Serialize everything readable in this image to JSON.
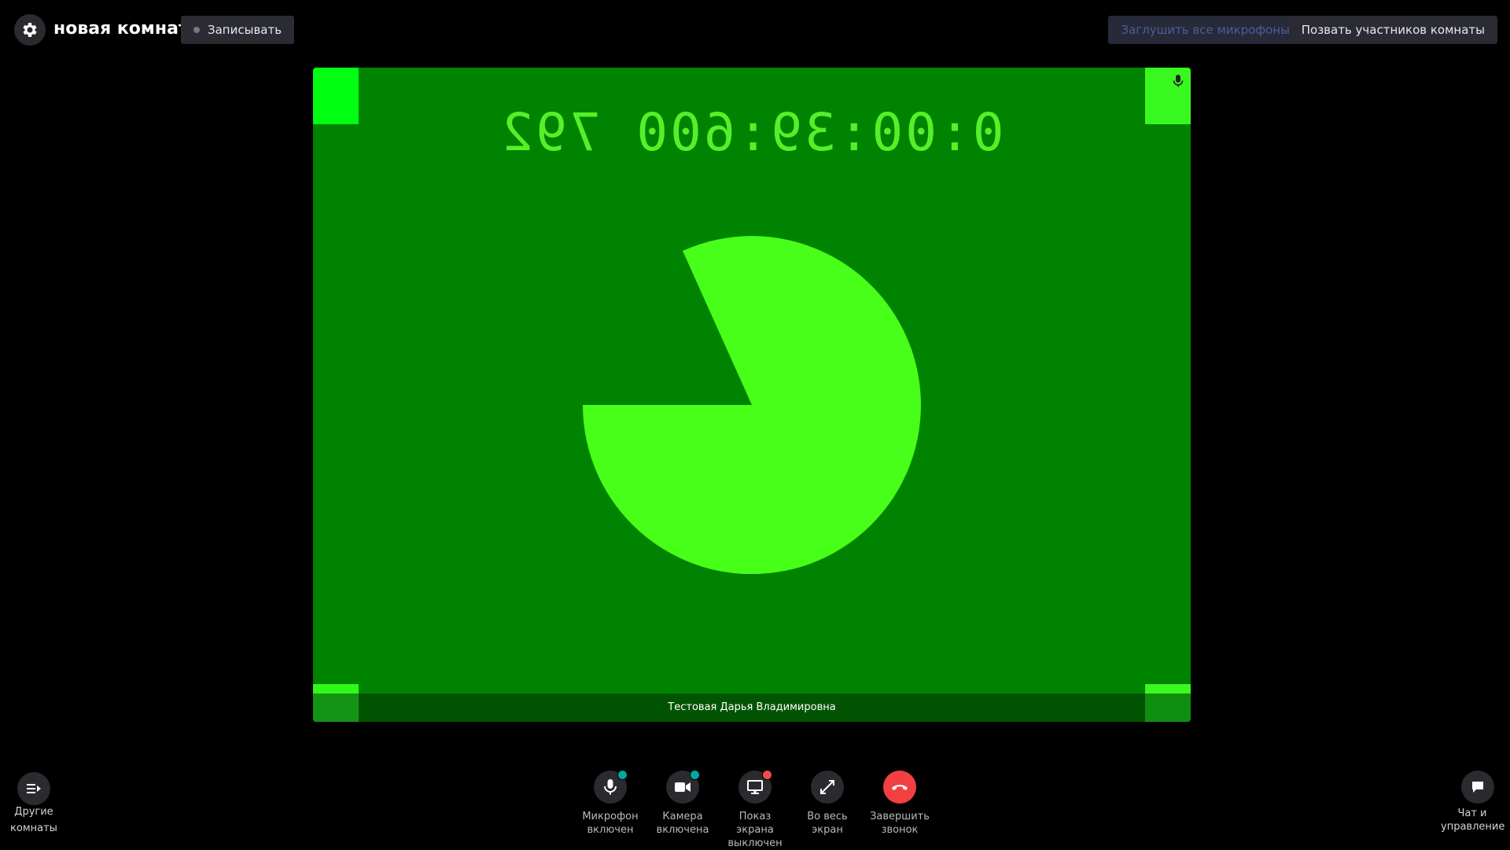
{
  "header": {
    "room_title": "новая комната",
    "record_label": "Записывать",
    "mute_all_label": "Заглушить все микрофоны",
    "invite_label": "Позвать участников комнаты"
  },
  "video": {
    "timestamp": "0:00:39:600 792",
    "participant_name": "Тестовая Дарья Владимировна",
    "mic_icon": "mic-icon"
  },
  "controls": {
    "mic": {
      "line1": "Микрофон",
      "line2": "включен",
      "status_color": "#00a99d"
    },
    "camera": {
      "line1": "Камера",
      "line2": "включена",
      "status_color": "#00a99d"
    },
    "screen": {
      "line1": "Показ экрана",
      "line2": "выключен",
      "status_color": "#f24b4b"
    },
    "fullscreen": {
      "line1": "Во весь",
      "line2": "экран"
    },
    "end_call": {
      "line1": "Завершить",
      "line2": "звонок",
      "color": "#f23f3f"
    }
  },
  "left_panel": {
    "line1": "Другие",
    "line2": "комнаты"
  },
  "right_panel": {
    "line1": "Чат и",
    "line2": "управление"
  },
  "colors": {
    "video_bg": "#008300",
    "pie": "#47ff18",
    "timestamp": "#56f02a"
  }
}
